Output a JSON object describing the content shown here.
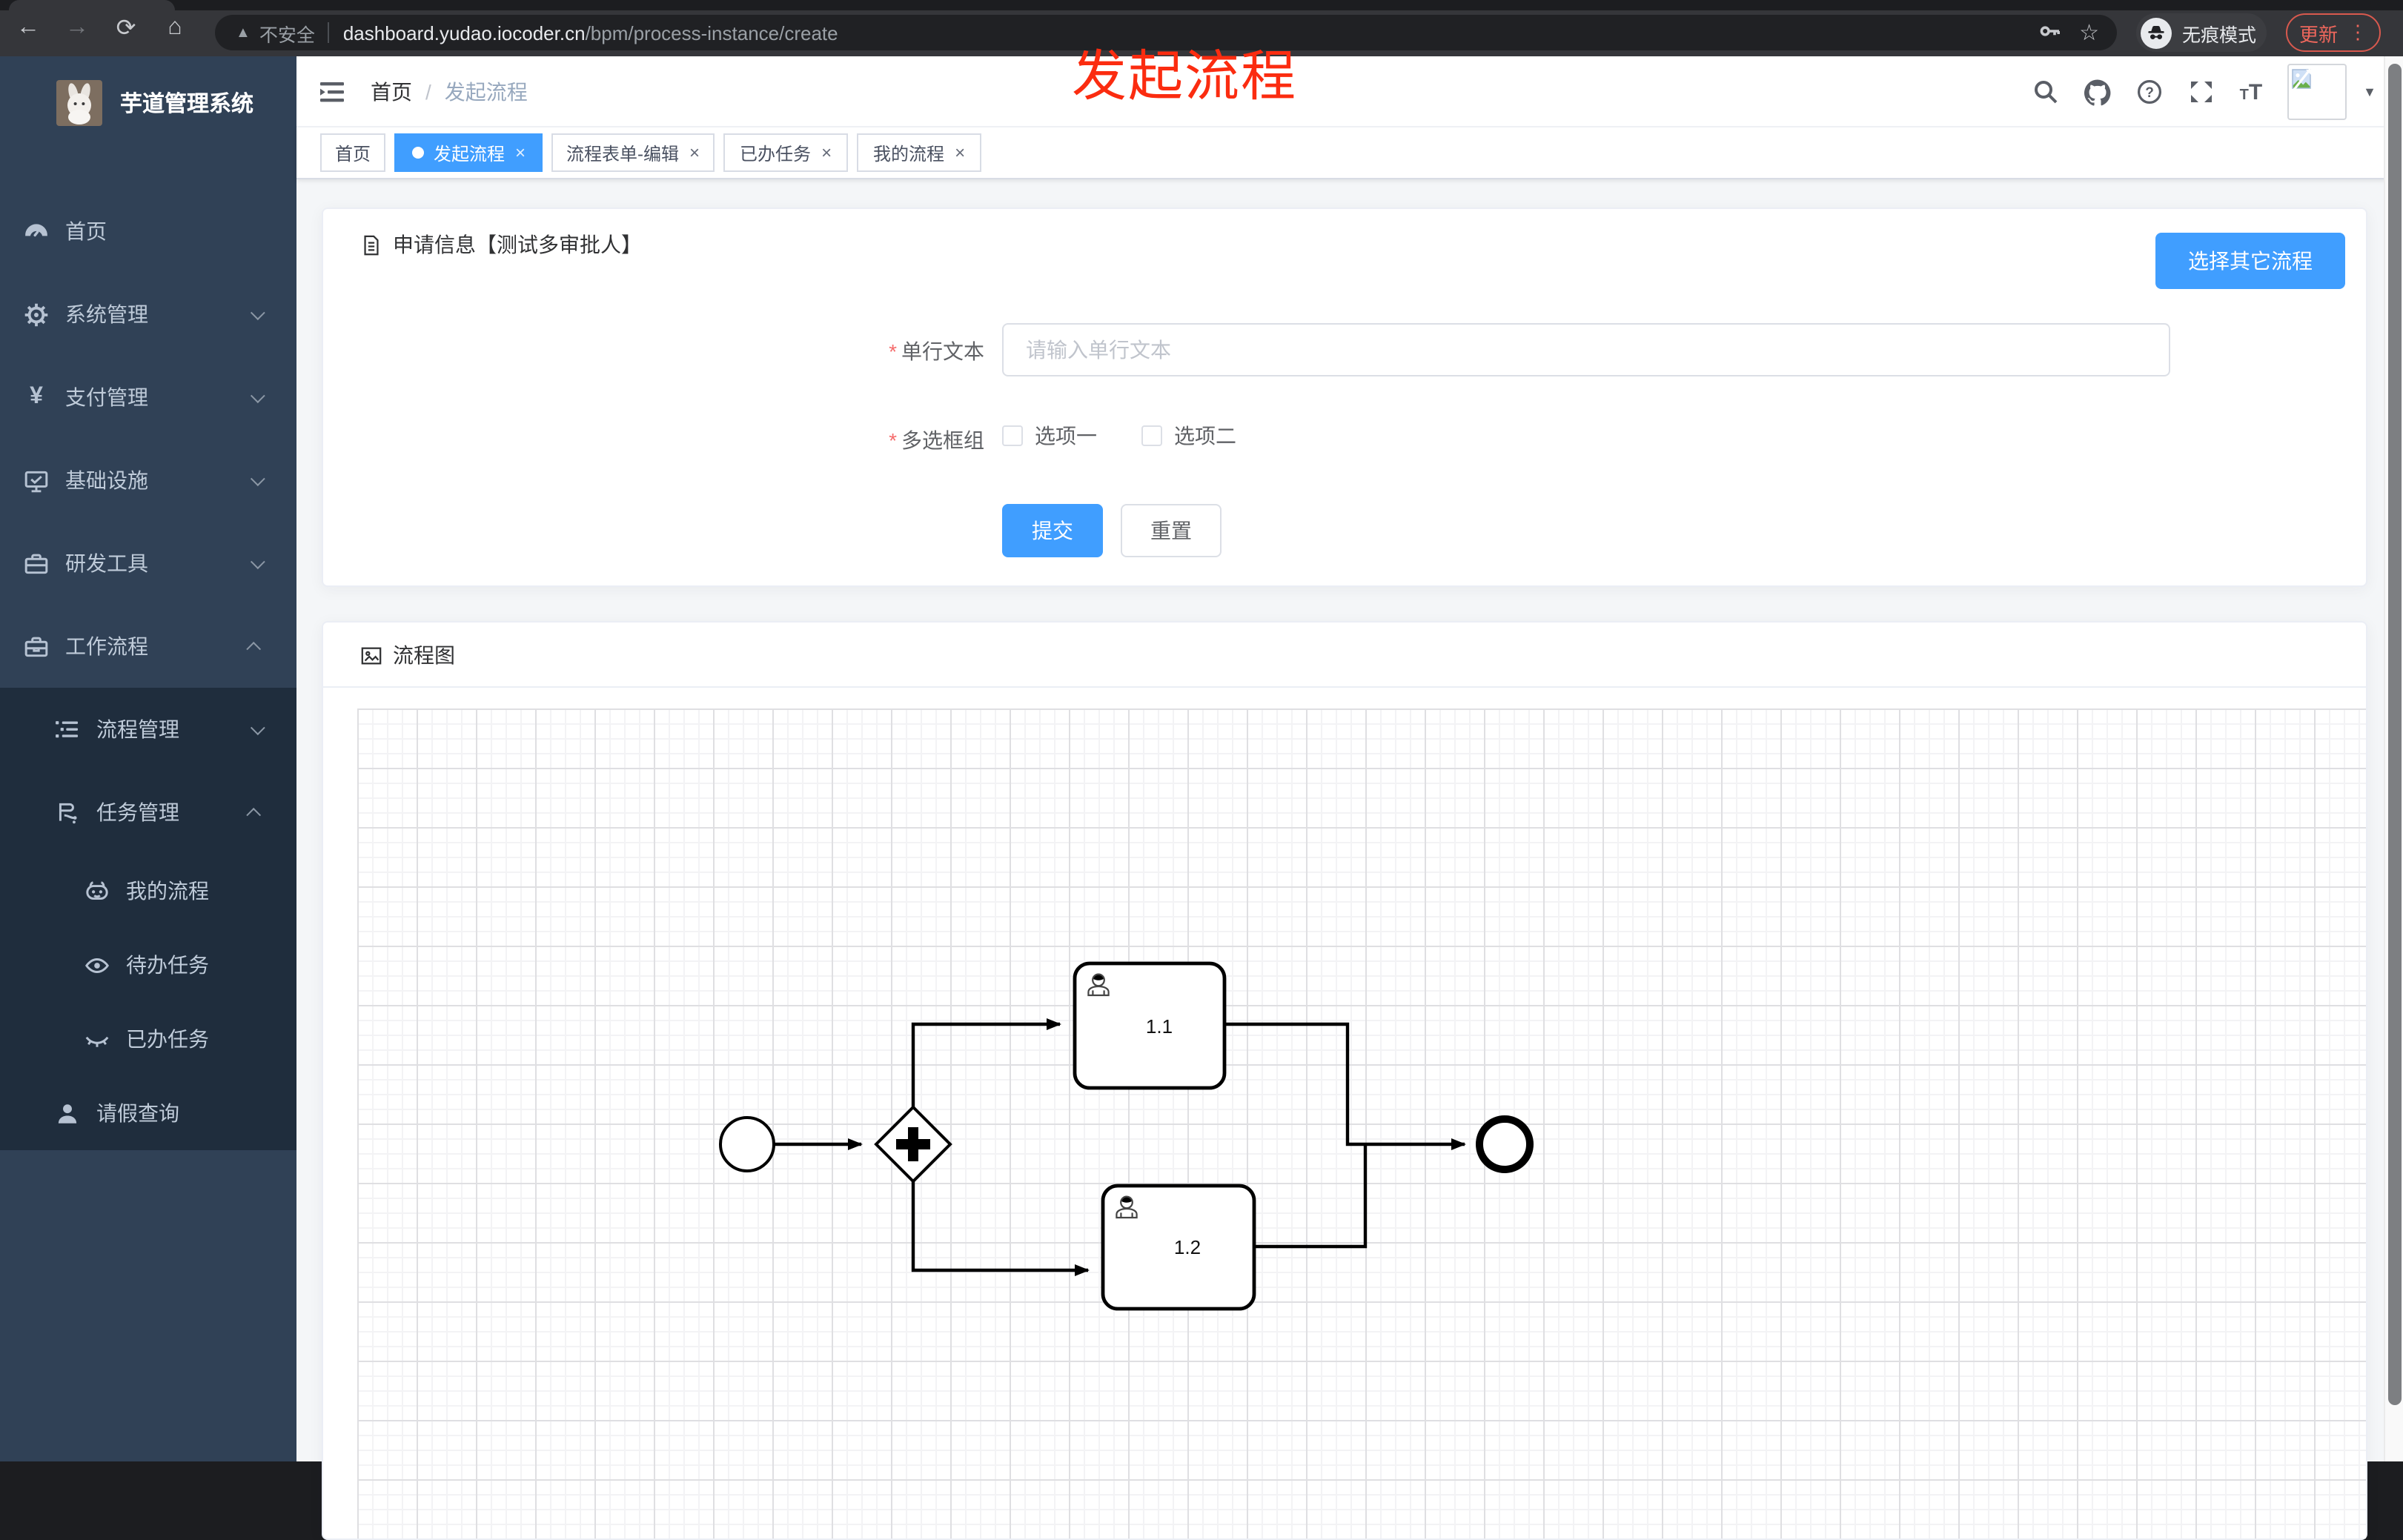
{
  "browser": {
    "security_label": "不安全",
    "url_host": "dashboard.yudao.iocoder.cn",
    "url_path": "/bpm/process-instance/create",
    "incognito_label": "无痕模式",
    "update_label": "更新"
  },
  "glyphs": {
    "back": "←",
    "forward": "→",
    "reload": "⟳",
    "home": "⌂",
    "warning": "▲",
    "star": "☆",
    "dots_vertical": "⋮",
    "breadcrumb_sep": "/",
    "close": "×",
    "caret_down": "▼"
  },
  "overlay": {
    "text": "发起流程",
    "color": "#fb2c10"
  },
  "sidebar": {
    "title": "芋道管理系统",
    "items": [
      {
        "label": "首页",
        "level": 1,
        "icon": "dashboard-icon",
        "chevron": ""
      },
      {
        "label": "系统管理",
        "level": 1,
        "icon": "gear-icon",
        "chevron": "down"
      },
      {
        "label": "支付管理",
        "level": 1,
        "icon": "yen-icon",
        "chevron": "down"
      },
      {
        "label": "基础设施",
        "level": 1,
        "icon": "monitor-icon",
        "chevron": "down"
      },
      {
        "label": "研发工具",
        "level": 1,
        "icon": "toolbox-icon",
        "chevron": "down"
      },
      {
        "label": "工作流程",
        "level": 1,
        "icon": "briefcase-icon",
        "chevron": "up"
      },
      {
        "label": "流程管理",
        "level": 2,
        "icon": "tree-list-icon",
        "chevron": "down"
      },
      {
        "label": "任务管理",
        "level": 2,
        "icon": "branch-icon",
        "chevron": "up"
      },
      {
        "label": "我的流程",
        "level": 3,
        "icon": "robot-icon",
        "chevron": ""
      },
      {
        "label": "待办任务",
        "level": 3,
        "icon": "eye-open-icon",
        "chevron": ""
      },
      {
        "label": "已办任务",
        "level": 3,
        "icon": "eye-closed-icon",
        "chevron": ""
      },
      {
        "label": "请假查询",
        "level": 2,
        "icon": "user-icon",
        "chevron": ""
      }
    ]
  },
  "header": {
    "breadcrumb_home": "首页",
    "breadcrumb_current": "发起流程"
  },
  "tabs": [
    {
      "label": "首页",
      "active": false,
      "closable": false
    },
    {
      "label": "发起流程",
      "active": true,
      "closable": true
    },
    {
      "label": "流程表单-编辑",
      "active": false,
      "closable": true
    },
    {
      "label": "已办任务",
      "active": false,
      "closable": true
    },
    {
      "label": "我的流程",
      "active": false,
      "closable": true
    }
  ],
  "form_card": {
    "title": "申请信息【测试多审批人】",
    "select_other_button": "选择其它流程",
    "required_mark": "*",
    "fields": [
      {
        "label": "单行文本",
        "required": true,
        "type": "input",
        "placeholder": "请输入单行文本",
        "value": ""
      },
      {
        "label": "多选框组",
        "required": true,
        "type": "checkbox-group",
        "options": [
          {
            "label": "选项一",
            "checked": false
          },
          {
            "label": "选项二",
            "checked": false
          }
        ]
      }
    ],
    "submit_label": "提交",
    "reset_label": "重置"
  },
  "diagram_card": {
    "title": "流程图",
    "diagram": {
      "type": "bpmn",
      "nodes": [
        {
          "id": "start",
          "type": "start-event",
          "label": ""
        },
        {
          "id": "gateway",
          "type": "parallel-gateway",
          "label": ""
        },
        {
          "id": "task11",
          "type": "user-task",
          "label": "1.1"
        },
        {
          "id": "task12",
          "type": "user-task",
          "label": "1.2"
        },
        {
          "id": "end",
          "type": "end-event",
          "label": ""
        }
      ],
      "flows": [
        [
          "start",
          "gateway"
        ],
        [
          "gateway",
          "task11"
        ],
        [
          "gateway",
          "task12"
        ],
        [
          "task11",
          "end"
        ],
        [
          "task12",
          "end"
        ]
      ]
    }
  },
  "colors": {
    "accent": "#409eff",
    "sidebar_bg": "#304156",
    "submenu_bg": "#1f2d3d",
    "overlay_red": "#fb2c10",
    "update_red": "#ee675c",
    "required_red": "#f56c6c"
  }
}
